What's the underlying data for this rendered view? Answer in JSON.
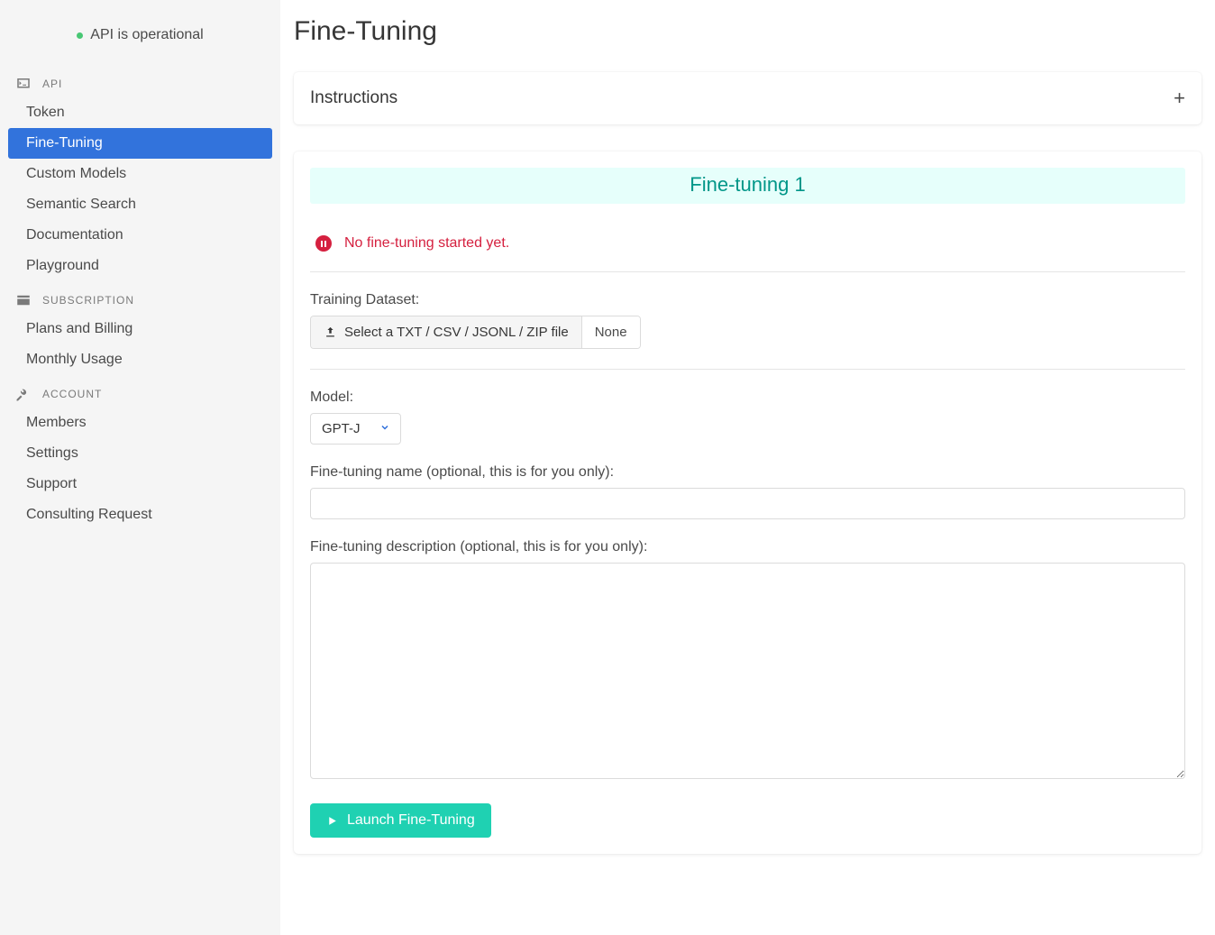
{
  "status": {
    "text": "API is operational"
  },
  "sidebar": {
    "sections": [
      {
        "label": "API"
      },
      {
        "label": "SUBSCRIPTION"
      },
      {
        "label": "ACCOUNT"
      }
    ],
    "api_items": [
      "Token",
      "Fine-Tuning",
      "Custom Models",
      "Semantic Search",
      "Documentation",
      "Playground"
    ],
    "subscription_items": [
      "Plans and Billing",
      "Monthly Usage"
    ],
    "account_items": [
      "Members",
      "Settings",
      "Support",
      "Consulting Request"
    ],
    "active": "Fine-Tuning"
  },
  "page": {
    "title": "Fine-Tuning"
  },
  "instructions": {
    "title": "Instructions"
  },
  "ft": {
    "banner": "Fine-tuning 1",
    "status_text": "No fine-tuning started yet.",
    "training_label": "Training Dataset:",
    "file_button": "Select a TXT / CSV / JSONL / ZIP file",
    "file_name": "None",
    "model_label": "Model:",
    "model_selected": "GPT-J",
    "name_label": "Fine-tuning name (optional, this is for you only):",
    "name_value": "",
    "desc_label": "Fine-tuning description (optional, this is for you only):",
    "desc_value": "",
    "launch_label": "Launch Fine-Tuning"
  }
}
